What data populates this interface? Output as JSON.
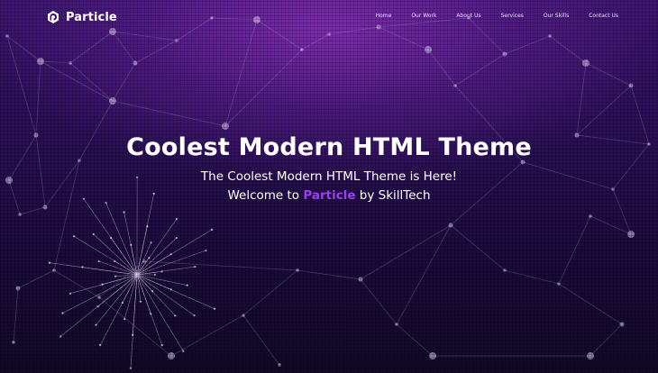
{
  "brand": {
    "name": "Particle",
    "icon": "particle-logo-icon"
  },
  "nav": {
    "items": [
      {
        "label": "Home"
      },
      {
        "label": "Our Work"
      },
      {
        "label": "About Us"
      },
      {
        "label": "Services"
      },
      {
        "label": "Our Skills"
      },
      {
        "label": "Contact Us"
      }
    ]
  },
  "hero": {
    "title": "Coolest Modern HTML Theme",
    "subtitle": "The Coolest Modern HTML Theme is Here!",
    "welcome_prefix": "Welcome to ",
    "welcome_brand": "Particle",
    "welcome_suffix": " by SkillTech"
  },
  "colors": {
    "accent": "#9b3ef0",
    "background_top": "#3a1370",
    "background_bottom": "#120828",
    "text": "#ffffff"
  }
}
